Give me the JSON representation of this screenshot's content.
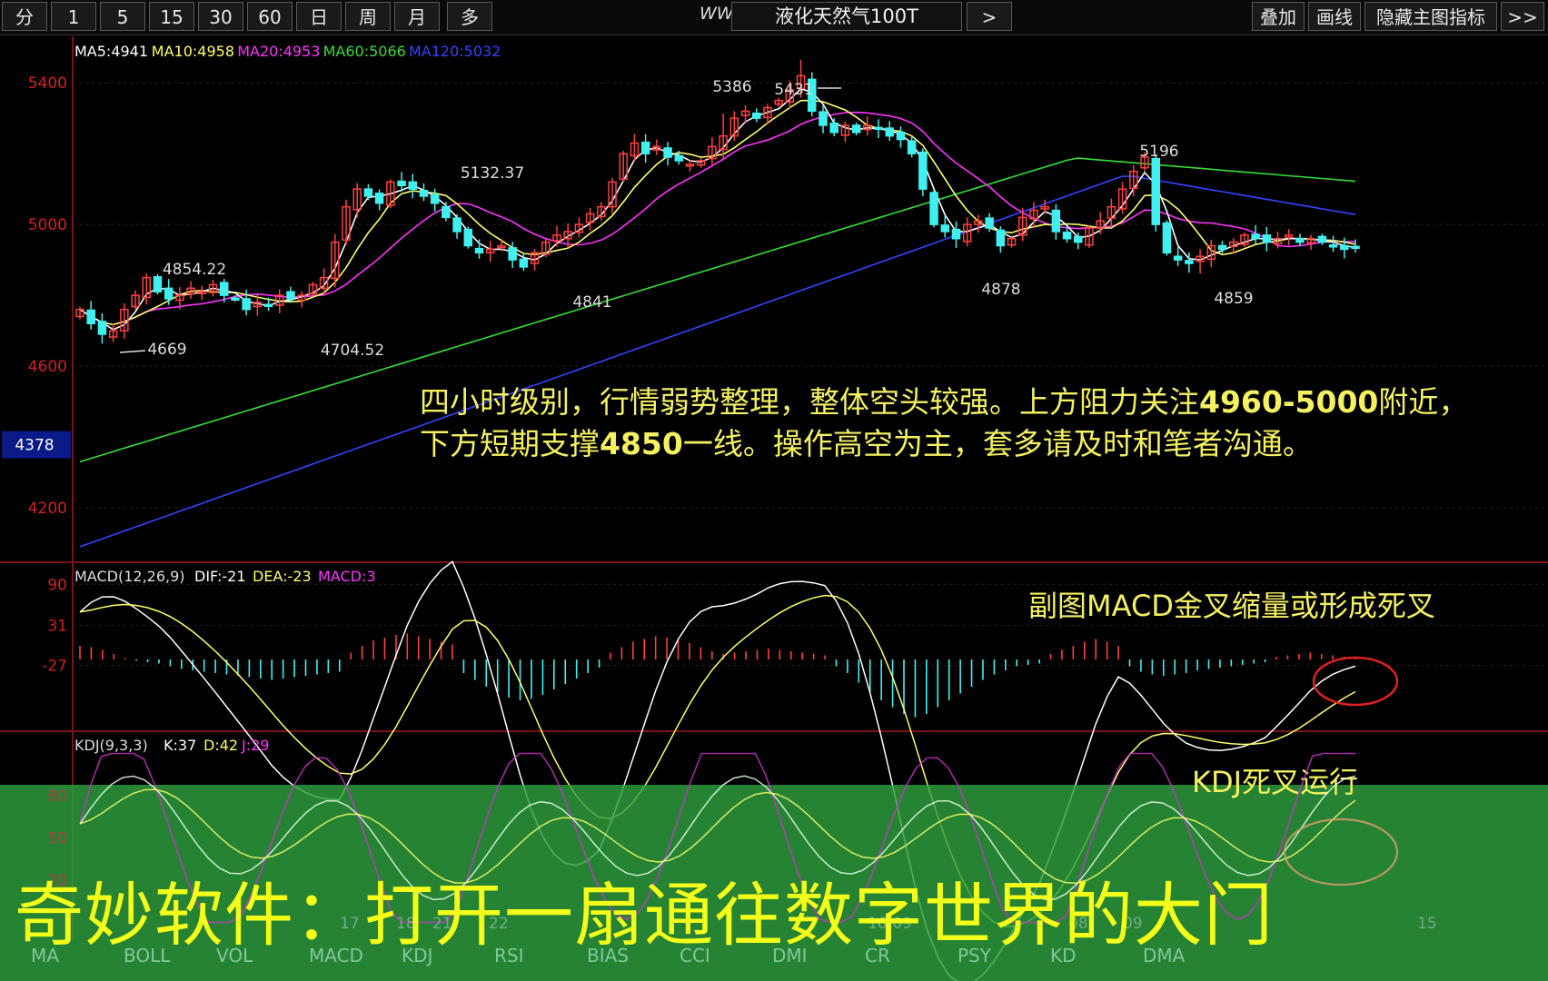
{
  "toolbar": {
    "periods": [
      "分",
      "1",
      "5",
      "15",
      "30",
      "60",
      "日",
      "周",
      "月",
      "多"
    ],
    "url_watermark": "WWW.QM5",
    "title": "液化天然气100T",
    "next_button": ">",
    "right_buttons": [
      "叠加",
      "画线",
      "隐藏主图指标",
      ">>"
    ]
  },
  "main_panel": {
    "ma_legend": [
      {
        "label": "MA5:4941",
        "color": "#ffffff"
      },
      {
        "label": "MA10:4958",
        "color": "#ffff66"
      },
      {
        "label": "MA20:4953",
        "color": "#ff33ff"
      },
      {
        "label": "MA60:5066",
        "color": "#33dd33"
      },
      {
        "label": "MA120:5032",
        "color": "#3344ff"
      }
    ],
    "y_ticks": [
      "5400",
      "5000",
      "4600",
      "4200"
    ],
    "current_price": "4378",
    "annotations": [
      "5386",
      "5431",
      "5132.37",
      "4854.22",
      "4669",
      "4704.52",
      "4841",
      "4878",
      "5196",
      "4859"
    ],
    "comment_line1_a": "四小时级别，行情弱势整理，整体空头较强。上方阻力关注",
    "comment_line1_b": "4960-5000",
    "comment_line1_c": "附近，",
    "comment_line2_a": "下方短期支撑",
    "comment_line2_b": "4850",
    "comment_line2_c": "一线。操作高空为主，套多请及时和笔者沟通。"
  },
  "macd_panel": {
    "legend_name": "MACD(12,26,9)",
    "dif": "DIF:-21",
    "dea": "DEA:-23",
    "macd": "MACD:3",
    "y_ticks": [
      "90",
      "31",
      "-27"
    ],
    "comment": "副图MACD金叉缩量或形成死叉"
  },
  "kdj_panel": {
    "legend_name": "KDJ(9,3,3)",
    "k": "K:37",
    "d": "D:42",
    "j": "J:29",
    "y_ticks": [
      "80",
      "50",
      "20"
    ],
    "comment": "KDJ死叉运行"
  },
  "x_date_labels": [
    "17",
    "18",
    "21",
    "22",
    "10/09",
    "08",
    "09",
    "15"
  ],
  "indicator_tabs": [
    "MA",
    "BOLL",
    "VOL",
    "MACD",
    "KDJ",
    "RSI",
    "BIAS",
    "CCI",
    "DMI",
    "CR",
    "PSY",
    "KD",
    "DMA"
  ],
  "caption": "奇妙软件：打开一扇通往数字世界的大门",
  "colors": {
    "up": "#ff4040",
    "down": "#40f0f0",
    "axis": "#d02020",
    "bg": "#000000",
    "band": "#2ea040",
    "caption": "#f4ff1a"
  },
  "chart_data": [
    {
      "type": "candlestick",
      "title": "液化天然气100T",
      "ylim": [
        4100,
        5480
      ],
      "close_path": [
        4760,
        4720,
        4690,
        4700,
        4760,
        4800,
        4850,
        4810,
        4790,
        4800,
        4820,
        4810,
        4830,
        4800,
        4790,
        4760,
        4780,
        4770,
        4800,
        4790,
        4800,
        4830,
        4850,
        4950,
        5050,
        5100,
        5080,
        5060,
        5120,
        5110,
        5100,
        5080,
        5060,
        5020,
        4980,
        4940,
        4920,
        4930,
        4940,
        4900,
        4880,
        4920,
        4950,
        4970,
        4980,
        5000,
        5030,
        5050,
        5120,
        5200,
        5230,
        5200,
        5220,
        5190,
        5180,
        5170,
        5180,
        5220,
        5250,
        5300,
        5320,
        5300,
        5330,
        5350,
        5380,
        5420,
        5320,
        5280,
        5260,
        5280,
        5260,
        5280,
        5270,
        5250,
        5240,
        5200,
        5100,
        5000,
        4980,
        4960,
        5000,
        5010,
        4990,
        4940,
        4960,
        5020,
        5040,
        5050,
        4980,
        4960,
        4950,
        4990,
        5010,
        5050,
        5100,
        5150,
        5190,
        5000,
        4920,
        4900,
        4890,
        4910,
        4940,
        4930,
        4950,
        4970,
        4960,
        4950,
        4960,
        4970,
        4950,
        4960,
        4950,
        4940,
        4930,
        4935
      ],
      "ma_series": [
        {
          "name": "MA5",
          "color": "#ffffff"
        },
        {
          "name": "MA10",
          "color": "#ffff66"
        },
        {
          "name": "MA20",
          "color": "#ff33ff"
        },
        {
          "name": "MA60",
          "color": "#33dd33"
        },
        {
          "name": "MA120",
          "color": "#3344ff"
        }
      ]
    },
    {
      "type": "bar",
      "title": "MACD(12,26,9)",
      "ylim": [
        -110,
        110
      ],
      "hist": [
        20,
        18,
        14,
        8,
        2,
        -2,
        -4,
        -6,
        -10,
        -14,
        -16,
        -18,
        -20,
        -22,
        -24,
        -26,
        -28,
        -30,
        -28,
        -26,
        -24,
        -22,
        -20,
        -18,
        10,
        20,
        28,
        32,
        36,
        38,
        34,
        30,
        26,
        22,
        -20,
        -30,
        -40,
        -48,
        -56,
        -60,
        -58,
        -52,
        -44,
        -36,
        -28,
        -20,
        -12,
        10,
        18,
        26,
        30,
        34,
        32,
        28,
        24,
        18,
        12,
        8,
        10,
        12,
        14,
        16,
        14,
        12,
        10,
        8,
        6,
        -10,
        -20,
        -34,
        -48,
        -60,
        -70,
        -80,
        -85,
        -80,
        -70,
        -60,
        -50,
        -40,
        -30,
        -22,
        -16,
        -10,
        -8,
        -6,
        8,
        14,
        20,
        26,
        30,
        26,
        20,
        -10,
        -18,
        -22,
        -24,
        -22,
        -20,
        -16,
        -14,
        -12,
        -10,
        -8,
        -6,
        -4,
        4,
        6,
        8,
        10,
        8,
        6,
        4,
        3
      ],
      "series": [
        {
          "name": "DIF",
          "color": "#ffffff"
        },
        {
          "name": "DEA",
          "color": "#ffff66"
        }
      ]
    },
    {
      "type": "line",
      "title": "KDJ(9,3,3)",
      "ylim": [
        0,
        100
      ],
      "series": [
        {
          "name": "K",
          "color": "#ffffff"
        },
        {
          "name": "D",
          "color": "#ffff66"
        },
        {
          "name": "J",
          "color": "#ff33ff"
        }
      ]
    }
  ]
}
